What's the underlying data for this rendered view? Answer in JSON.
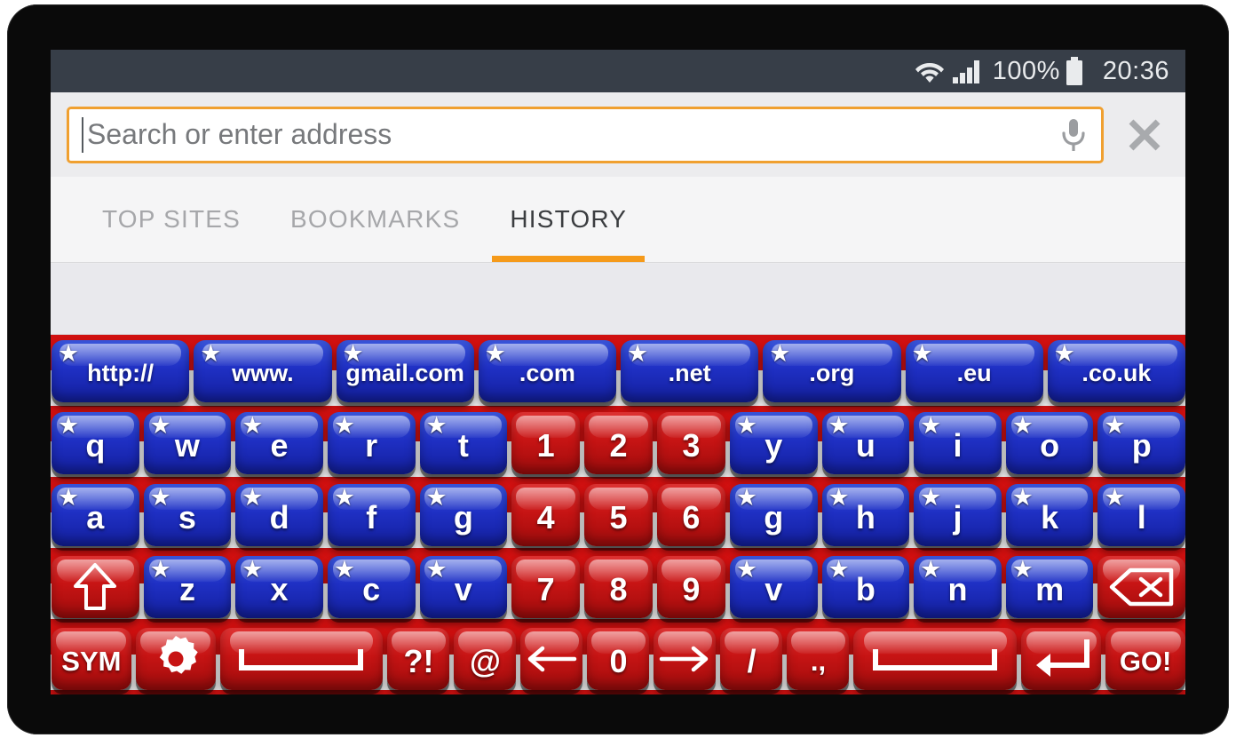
{
  "statusbar": {
    "wifi_icon": "wifi-icon",
    "signal_icon": "signal-bars-icon",
    "battery_percent": "100%",
    "battery_icon": "battery-full-icon",
    "clock": "20:36"
  },
  "urlbar": {
    "placeholder": "Search or enter address",
    "value": "",
    "mic_icon": "microphone-icon",
    "close_icon": "close-x-icon"
  },
  "tabs": [
    {
      "label": "TOP SITES",
      "active": false
    },
    {
      "label": "BOOKMARKS",
      "active": false
    },
    {
      "label": "HISTORY",
      "active": true
    }
  ],
  "colors": {
    "accent_orange": "#f59a1a",
    "url_border": "#f0a030",
    "statusbar_bg": "#373e48",
    "keyboard_red": "#ce1212",
    "key_blue": "#1f30c4",
    "key_red": "#c71414"
  },
  "keyboard": {
    "rows": [
      {
        "name": "shortcut-row",
        "keys": [
          {
            "label": "http://",
            "color": "blue",
            "star": true,
            "size": "tiny",
            "width": "w-top"
          },
          {
            "label": "www.",
            "color": "blue",
            "star": true,
            "size": "tiny",
            "width": "w-top"
          },
          {
            "label": "gmail.com",
            "color": "blue",
            "star": true,
            "size": "tiny",
            "width": "w-top"
          },
          {
            "label": ".com",
            "color": "blue",
            "star": true,
            "size": "tiny",
            "width": "w-top"
          },
          {
            "label": ".net",
            "color": "blue",
            "star": true,
            "size": "tiny",
            "width": "w-top"
          },
          {
            "label": ".org",
            "color": "blue",
            "star": true,
            "size": "tiny",
            "width": "w-top"
          },
          {
            "label": ".eu",
            "color": "blue",
            "star": true,
            "size": "tiny",
            "width": "w-top"
          },
          {
            "label": ".co.uk",
            "color": "blue",
            "star": true,
            "size": "tiny",
            "width": "w-top"
          }
        ]
      },
      {
        "name": "qwerty-row",
        "keys": [
          {
            "label": "q",
            "color": "blue",
            "star": true,
            "width": "w-1"
          },
          {
            "label": "w",
            "color": "blue",
            "star": true,
            "width": "w-1"
          },
          {
            "label": "e",
            "color": "blue",
            "star": true,
            "width": "w-1"
          },
          {
            "label": "r",
            "color": "blue",
            "star": true,
            "width": "w-1"
          },
          {
            "label": "t",
            "color": "blue",
            "star": true,
            "width": "w-1"
          },
          {
            "label": "1",
            "color": "red",
            "star": false,
            "width": "w-half"
          },
          {
            "label": "2",
            "color": "red",
            "star": false,
            "width": "w-half"
          },
          {
            "label": "3",
            "color": "red",
            "star": false,
            "width": "w-half"
          },
          {
            "label": "y",
            "color": "blue",
            "star": true,
            "width": "w-1"
          },
          {
            "label": "u",
            "color": "blue",
            "star": true,
            "width": "w-1"
          },
          {
            "label": "i",
            "color": "blue",
            "star": true,
            "width": "w-1"
          },
          {
            "label": "o",
            "color": "blue",
            "star": true,
            "width": "w-1"
          },
          {
            "label": "p",
            "color": "blue",
            "star": true,
            "width": "w-1"
          }
        ]
      },
      {
        "name": "asdf-row",
        "keys": [
          {
            "label": "a",
            "color": "blue",
            "star": true,
            "width": "w-1"
          },
          {
            "label": "s",
            "color": "blue",
            "star": true,
            "width": "w-1"
          },
          {
            "label": "d",
            "color": "blue",
            "star": true,
            "width": "w-1"
          },
          {
            "label": "f",
            "color": "blue",
            "star": true,
            "width": "w-1"
          },
          {
            "label": "g",
            "color": "blue",
            "star": true,
            "width": "w-1"
          },
          {
            "label": "4",
            "color": "red",
            "star": false,
            "width": "w-half"
          },
          {
            "label": "5",
            "color": "red",
            "star": false,
            "width": "w-half"
          },
          {
            "label": "6",
            "color": "red",
            "star": false,
            "width": "w-half"
          },
          {
            "label": "g",
            "color": "blue",
            "star": true,
            "width": "w-1"
          },
          {
            "label": "h",
            "color": "blue",
            "star": true,
            "width": "w-1"
          },
          {
            "label": "j",
            "color": "blue",
            "star": true,
            "width": "w-1"
          },
          {
            "label": "k",
            "color": "blue",
            "star": true,
            "width": "w-1"
          },
          {
            "label": "l",
            "color": "blue",
            "star": true,
            "width": "w-1"
          }
        ]
      },
      {
        "name": "zxcv-row",
        "keys": [
          {
            "label": "",
            "icon": "shift-up-arrow-icon",
            "color": "red",
            "star": false,
            "width": "w-1"
          },
          {
            "label": "z",
            "color": "blue",
            "star": true,
            "width": "w-1"
          },
          {
            "label": "x",
            "color": "blue",
            "star": true,
            "width": "w-1"
          },
          {
            "label": "c",
            "color": "blue",
            "star": true,
            "width": "w-1"
          },
          {
            "label": "v",
            "color": "blue",
            "star": true,
            "width": "w-1"
          },
          {
            "label": "7",
            "color": "red",
            "star": false,
            "width": "w-half"
          },
          {
            "label": "8",
            "color": "red",
            "star": false,
            "width": "w-half"
          },
          {
            "label": "9",
            "color": "red",
            "star": false,
            "width": "w-half"
          },
          {
            "label": "v",
            "color": "blue",
            "star": true,
            "width": "w-1"
          },
          {
            "label": "b",
            "color": "blue",
            "star": true,
            "width": "w-1"
          },
          {
            "label": "n",
            "color": "blue",
            "star": true,
            "width": "w-1"
          },
          {
            "label": "m",
            "color": "blue",
            "star": true,
            "width": "w-1"
          },
          {
            "label": "",
            "icon": "backspace-icon",
            "color": "red",
            "star": false,
            "width": "w-1"
          }
        ]
      },
      {
        "name": "bottom-row",
        "keys": [
          {
            "label": "SYM",
            "color": "red",
            "star": false,
            "size": "small",
            "width": "w-1"
          },
          {
            "label": "",
            "icon": "settings-gear-icon",
            "color": "red",
            "star": false,
            "width": "w-1"
          },
          {
            "label": "",
            "icon": "space-bar-icon",
            "color": "red",
            "star": false,
            "width": "w-space"
          },
          {
            "label": "?!",
            "color": "red",
            "star": false,
            "width": "w-half"
          },
          {
            "label": "@",
            "color": "red",
            "star": false,
            "width": "w-half"
          },
          {
            "label": "",
            "icon": "arrow-left-icon",
            "color": "red",
            "star": false,
            "width": "w-half"
          },
          {
            "label": "0",
            "color": "red",
            "star": false,
            "width": "w-half"
          },
          {
            "label": "",
            "icon": "arrow-right-icon",
            "color": "red",
            "star": false,
            "width": "w-half"
          },
          {
            "label": "/",
            "color": "red",
            "star": false,
            "width": "w-half"
          },
          {
            "label": ".,",
            "color": "red",
            "star": false,
            "size": "small",
            "width": "w-half"
          },
          {
            "label": "",
            "icon": "space-bar-icon",
            "color": "red",
            "star": false,
            "width": "w-space"
          },
          {
            "label": "",
            "icon": "enter-return-icon",
            "color": "red",
            "star": false,
            "width": "w-1"
          },
          {
            "label": "GO!",
            "color": "red",
            "star": false,
            "size": "small",
            "width": "w-1"
          }
        ]
      }
    ]
  }
}
